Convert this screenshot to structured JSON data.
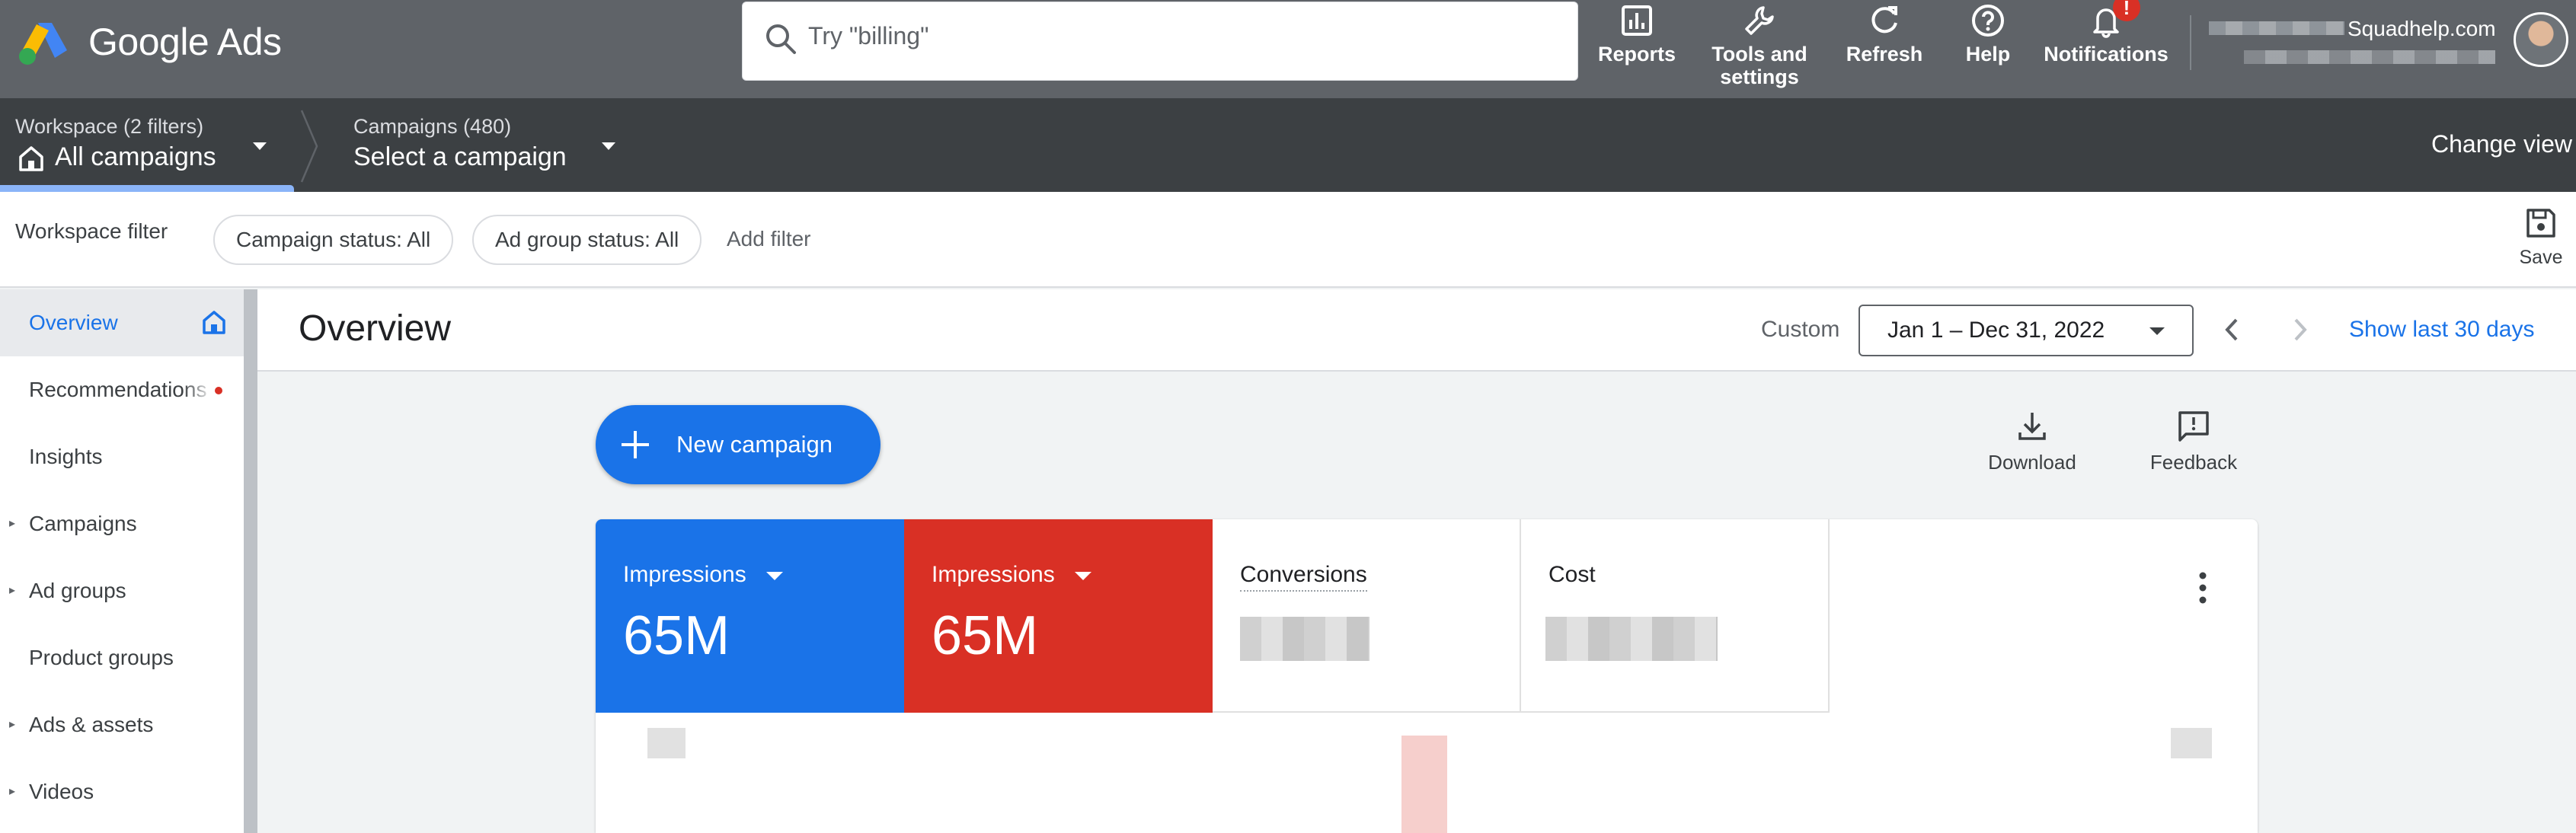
{
  "topbar": {
    "brand": "Google Ads",
    "search_placeholder": "Try \"billing\"",
    "buttons": {
      "reports": "Reports",
      "tools": "Tools and settings",
      "refresh": "Refresh",
      "help": "Help",
      "notifications": "Notifications"
    },
    "notification_badge": "!",
    "account_email": "Squadhelp.com"
  },
  "navbar": {
    "workspace_label": "Workspace (2 filters)",
    "workspace_value": "All campaigns",
    "campaigns_label": "Campaigns (480)",
    "campaigns_value": "Select a campaign",
    "change_view": "Change view"
  },
  "filterbar": {
    "label": "Workspace filter",
    "chips": [
      "Campaign status: All",
      "Ad group status: All"
    ],
    "add_filter": "Add filter",
    "save": "Save"
  },
  "sidebar": {
    "items": [
      {
        "label": "Overview",
        "active": true
      },
      {
        "label": "Recommendations",
        "dot": true
      },
      {
        "label": "Insights"
      },
      {
        "label": "Campaigns",
        "expandable": true
      },
      {
        "label": "Ad groups",
        "expandable": true
      },
      {
        "label": "Product groups"
      },
      {
        "label": "Ads & assets",
        "expandable": true
      },
      {
        "label": "Videos",
        "expandable": true
      }
    ]
  },
  "overview": {
    "title": "Overview",
    "custom_label": "Custom",
    "date_range": "Jan 1 – Dec 31, 2022",
    "show_last": "Show last 30 days",
    "new_campaign": "New campaign",
    "download": "Download",
    "feedback": "Feedback"
  },
  "scorecards": [
    {
      "label": "Impressions",
      "value": "65M",
      "color": "#1a73e8"
    },
    {
      "label": "Impressions",
      "value": "65M",
      "color": "#d93025"
    },
    {
      "label": "Conversions",
      "value": ""
    },
    {
      "label": "Cost",
      "value": ""
    }
  ],
  "colors": {
    "topbar": "#5f6368",
    "navbar": "#3c4043",
    "accent_blue": "#1a73e8",
    "accent_red": "#d93025"
  }
}
